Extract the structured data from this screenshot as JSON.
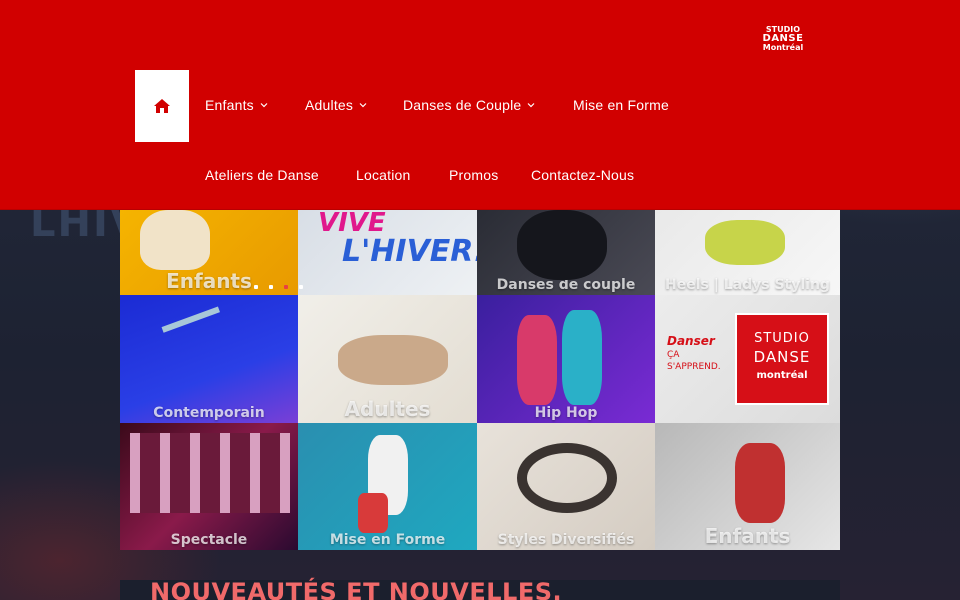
{
  "header": {
    "logo": {
      "line1": "STUDIO",
      "line2": "DANSE",
      "line3": "Montréal"
    },
    "nav": [
      {
        "label": "Enfants",
        "has_dropdown": true
      },
      {
        "label": "Adultes",
        "has_dropdown": true
      },
      {
        "label": "Danses de Couple",
        "has_dropdown": true
      },
      {
        "label": "Mise en Forme",
        "has_dropdown": false
      },
      {
        "label": "Ateliers de Danse",
        "has_dropdown": false
      },
      {
        "label": "Location",
        "has_dropdown": false
      },
      {
        "label": "Promos",
        "has_dropdown": false
      },
      {
        "label": "Contactez-Nous",
        "has_dropdown": false
      }
    ],
    "home_icon": "home-icon"
  },
  "background": {
    "text": "LHIVE"
  },
  "grid": {
    "tiles": [
      {
        "label": "Enfants"
      },
      {
        "label": "",
        "promo_line1": "VIVE",
        "promo_line2": "L'HIVER!"
      },
      {
        "label": "Danses de couple"
      },
      {
        "label": "Heels | Ladys Styling"
      },
      {
        "label": "Contemporain"
      },
      {
        "label": "Adultes"
      },
      {
        "label": "Hip Hop"
      },
      {
        "label": "",
        "studio_line1": "STUDIO",
        "studio_line2": "DANSE",
        "studio_line3": "montréal",
        "tag1": "Danser",
        "tag2": "ÇA",
        "tag3": "S'APPREND."
      },
      {
        "label": "Spectacle"
      },
      {
        "label": "Mise en Forme"
      },
      {
        "label": "Styles Diversifiés"
      },
      {
        "label": "Enfants"
      }
    ],
    "slider_active_index": 2
  },
  "news": {
    "title": "NOUVEAUTÉS ET NOUVELLES."
  },
  "colors": {
    "brand_red": "#d10000",
    "accent_text": "#f06a6a"
  }
}
